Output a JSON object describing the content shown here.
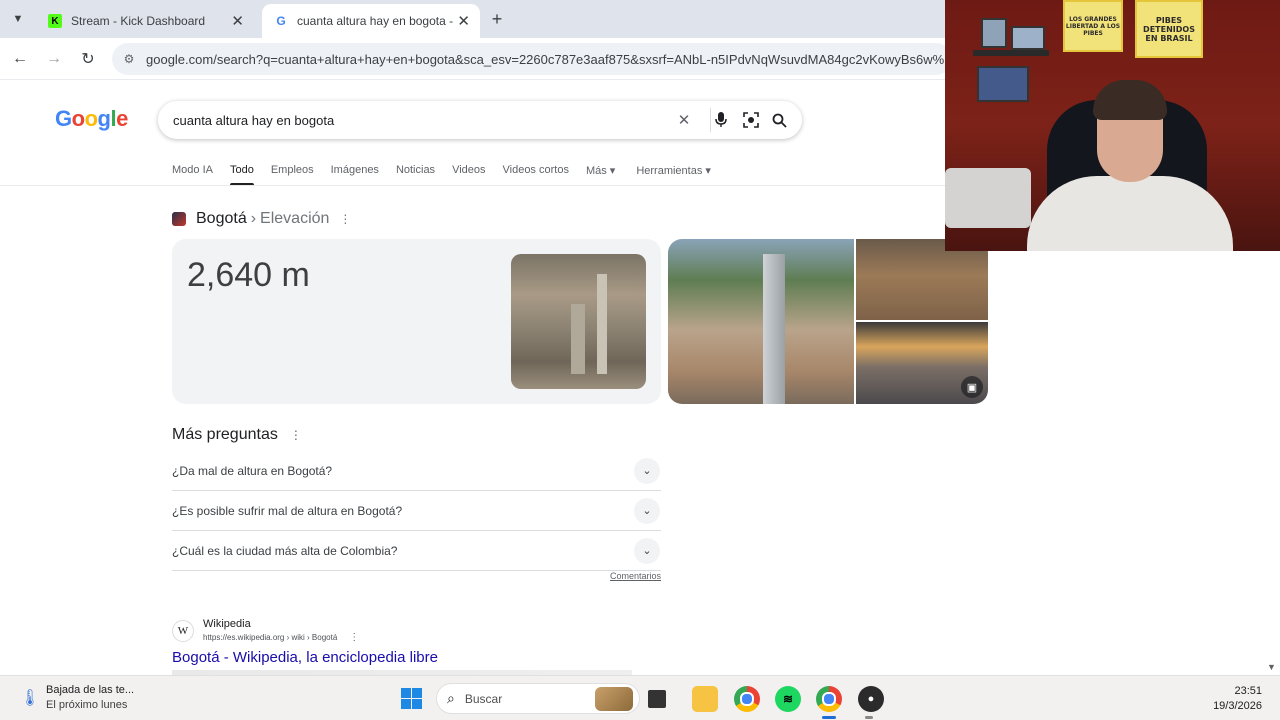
{
  "browser": {
    "tabs": [
      {
        "title": "Stream - Kick Dashboard",
        "favicon": "kick-icon",
        "active": false
      },
      {
        "title": "cuanta altura hay en bogota - B",
        "favicon": "google-icon",
        "active": true
      }
    ],
    "url": "google.com/search?q=cuanta+altura+hay+en+bogota&sca_esv=2260c787e3aaf875&sxsrf=ANbL-n5IPdvNqWsuvdMA84gc2vKowyBs6w%"
  },
  "google": {
    "logo": [
      "G",
      "o",
      "o",
      "g",
      "l",
      "e"
    ],
    "query": "cuanta altura hay en bogota",
    "tabs": [
      "Modo IA",
      "Todo",
      "Empleos",
      "Imágenes",
      "Noticias",
      "Videos",
      "Videos cortos",
      "Más ▾",
      "Herramientas ▾"
    ],
    "active_tab": "Todo"
  },
  "answer": {
    "entity": "Bogotá",
    "separator": "›",
    "attribute": "Elevación",
    "value": "2,640 m"
  },
  "people_also_ask": {
    "title": "Más preguntas",
    "questions": [
      "¿Da mal de altura en Bogotá?",
      "¿Es posible sufrir mal de altura en Bogotá?",
      "¿Cuál es la ciudad más alta de Colombia?"
    ],
    "feedback": "Comentarios"
  },
  "result": {
    "favicon_letter": "W",
    "site": "Wikipedia",
    "url": "https://es.wikipedia.org › wiki › Bogotá",
    "title": "Bogotá - Wikipedia, la enciclopedia libre"
  },
  "webcam": {
    "poster1": "LOS GRANDES LIBERTAD A LOS PIBES",
    "poster2": "PIBES DETENIDOS EN BRASIL"
  },
  "taskbar": {
    "weather_title": "Bajada de las te...",
    "weather_sub": "El próximo lunes",
    "search_placeholder": "Buscar",
    "time": "23:51",
    "date": "19/3/2026"
  }
}
